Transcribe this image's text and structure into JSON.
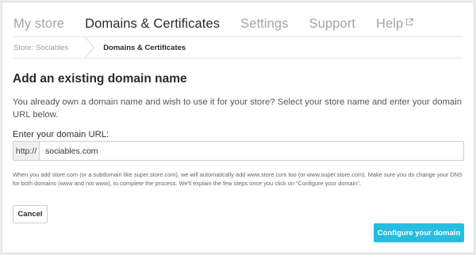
{
  "nav": {
    "items": [
      {
        "label": "My store",
        "active": false
      },
      {
        "label": "Domains & Certificates",
        "active": true
      },
      {
        "label": "Settings",
        "active": false
      },
      {
        "label": "Support",
        "active": false
      },
      {
        "label": "Help",
        "active": false,
        "icon": "external-link-icon"
      }
    ]
  },
  "breadcrumb": {
    "parent": "Store: Sociables",
    "current": "Domains & Certificates"
  },
  "form": {
    "title": "Add an existing domain name",
    "description": "You already own a domain name and wish to use it for your store? Select your store name and enter your domain URL below.",
    "label": "Enter your domain URL:",
    "prefix": "http://",
    "value": "sociables.com",
    "note": "When you add store.com (or a subdomain like super.store.com), we will automatically add www.store.com too (or www.super.store.com). Make sure you do change your DNS for both domains (www and not www), to complete the process. We'll explain the few steps once you click on \"Configure your domain\".",
    "cancel_label": "Cancel",
    "submit_label": "Configure your domain"
  },
  "colors": {
    "accent": "#27bde0",
    "active_text": "#2b2b2b",
    "muted_text": "#a4a4a4"
  }
}
